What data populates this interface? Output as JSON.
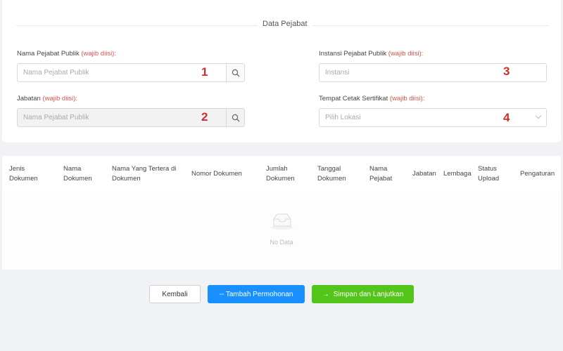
{
  "section": {
    "title": "Data Pejabat"
  },
  "form": {
    "required_text": "(wajib diisi):",
    "nama": {
      "label": "Nama Pejabat Publik",
      "placeholder": "Nama Pejabat Publik",
      "marker": "1"
    },
    "instansi": {
      "label": "Instansi Pejabat Publik",
      "placeholder": "Instansi",
      "marker": "3"
    },
    "jabatan": {
      "label": "Jabatan",
      "placeholder": "Nama Pejabat Publik",
      "marker": "2"
    },
    "tempat": {
      "label": "Tempat Cetak Sertifikat",
      "placeholder": "Pilih Lokasi",
      "marker": "4"
    }
  },
  "table": {
    "columns": [
      [
        "Jenis",
        "Dokumen"
      ],
      [
        "Nama",
        "Dokumen"
      ],
      [
        "Nama Yang Tertera di",
        "Dokumen"
      ],
      [
        "Nomor Dokumen"
      ],
      [
        "Jumlah",
        "Dokumen"
      ],
      [
        "Tanggal",
        "Dokumen"
      ],
      [
        "Nama",
        "Pejabat"
      ],
      [
        "Jabatan"
      ],
      [
        "Lembaga"
      ],
      [
        "Status",
        "Upload"
      ],
      [
        "Pengaturan"
      ]
    ],
    "empty_text": "No Data"
  },
  "actions": {
    "back": "Kembali",
    "add": "-- Tambah Permohonan",
    "save": "Simpan dan Lanjutkan"
  }
}
